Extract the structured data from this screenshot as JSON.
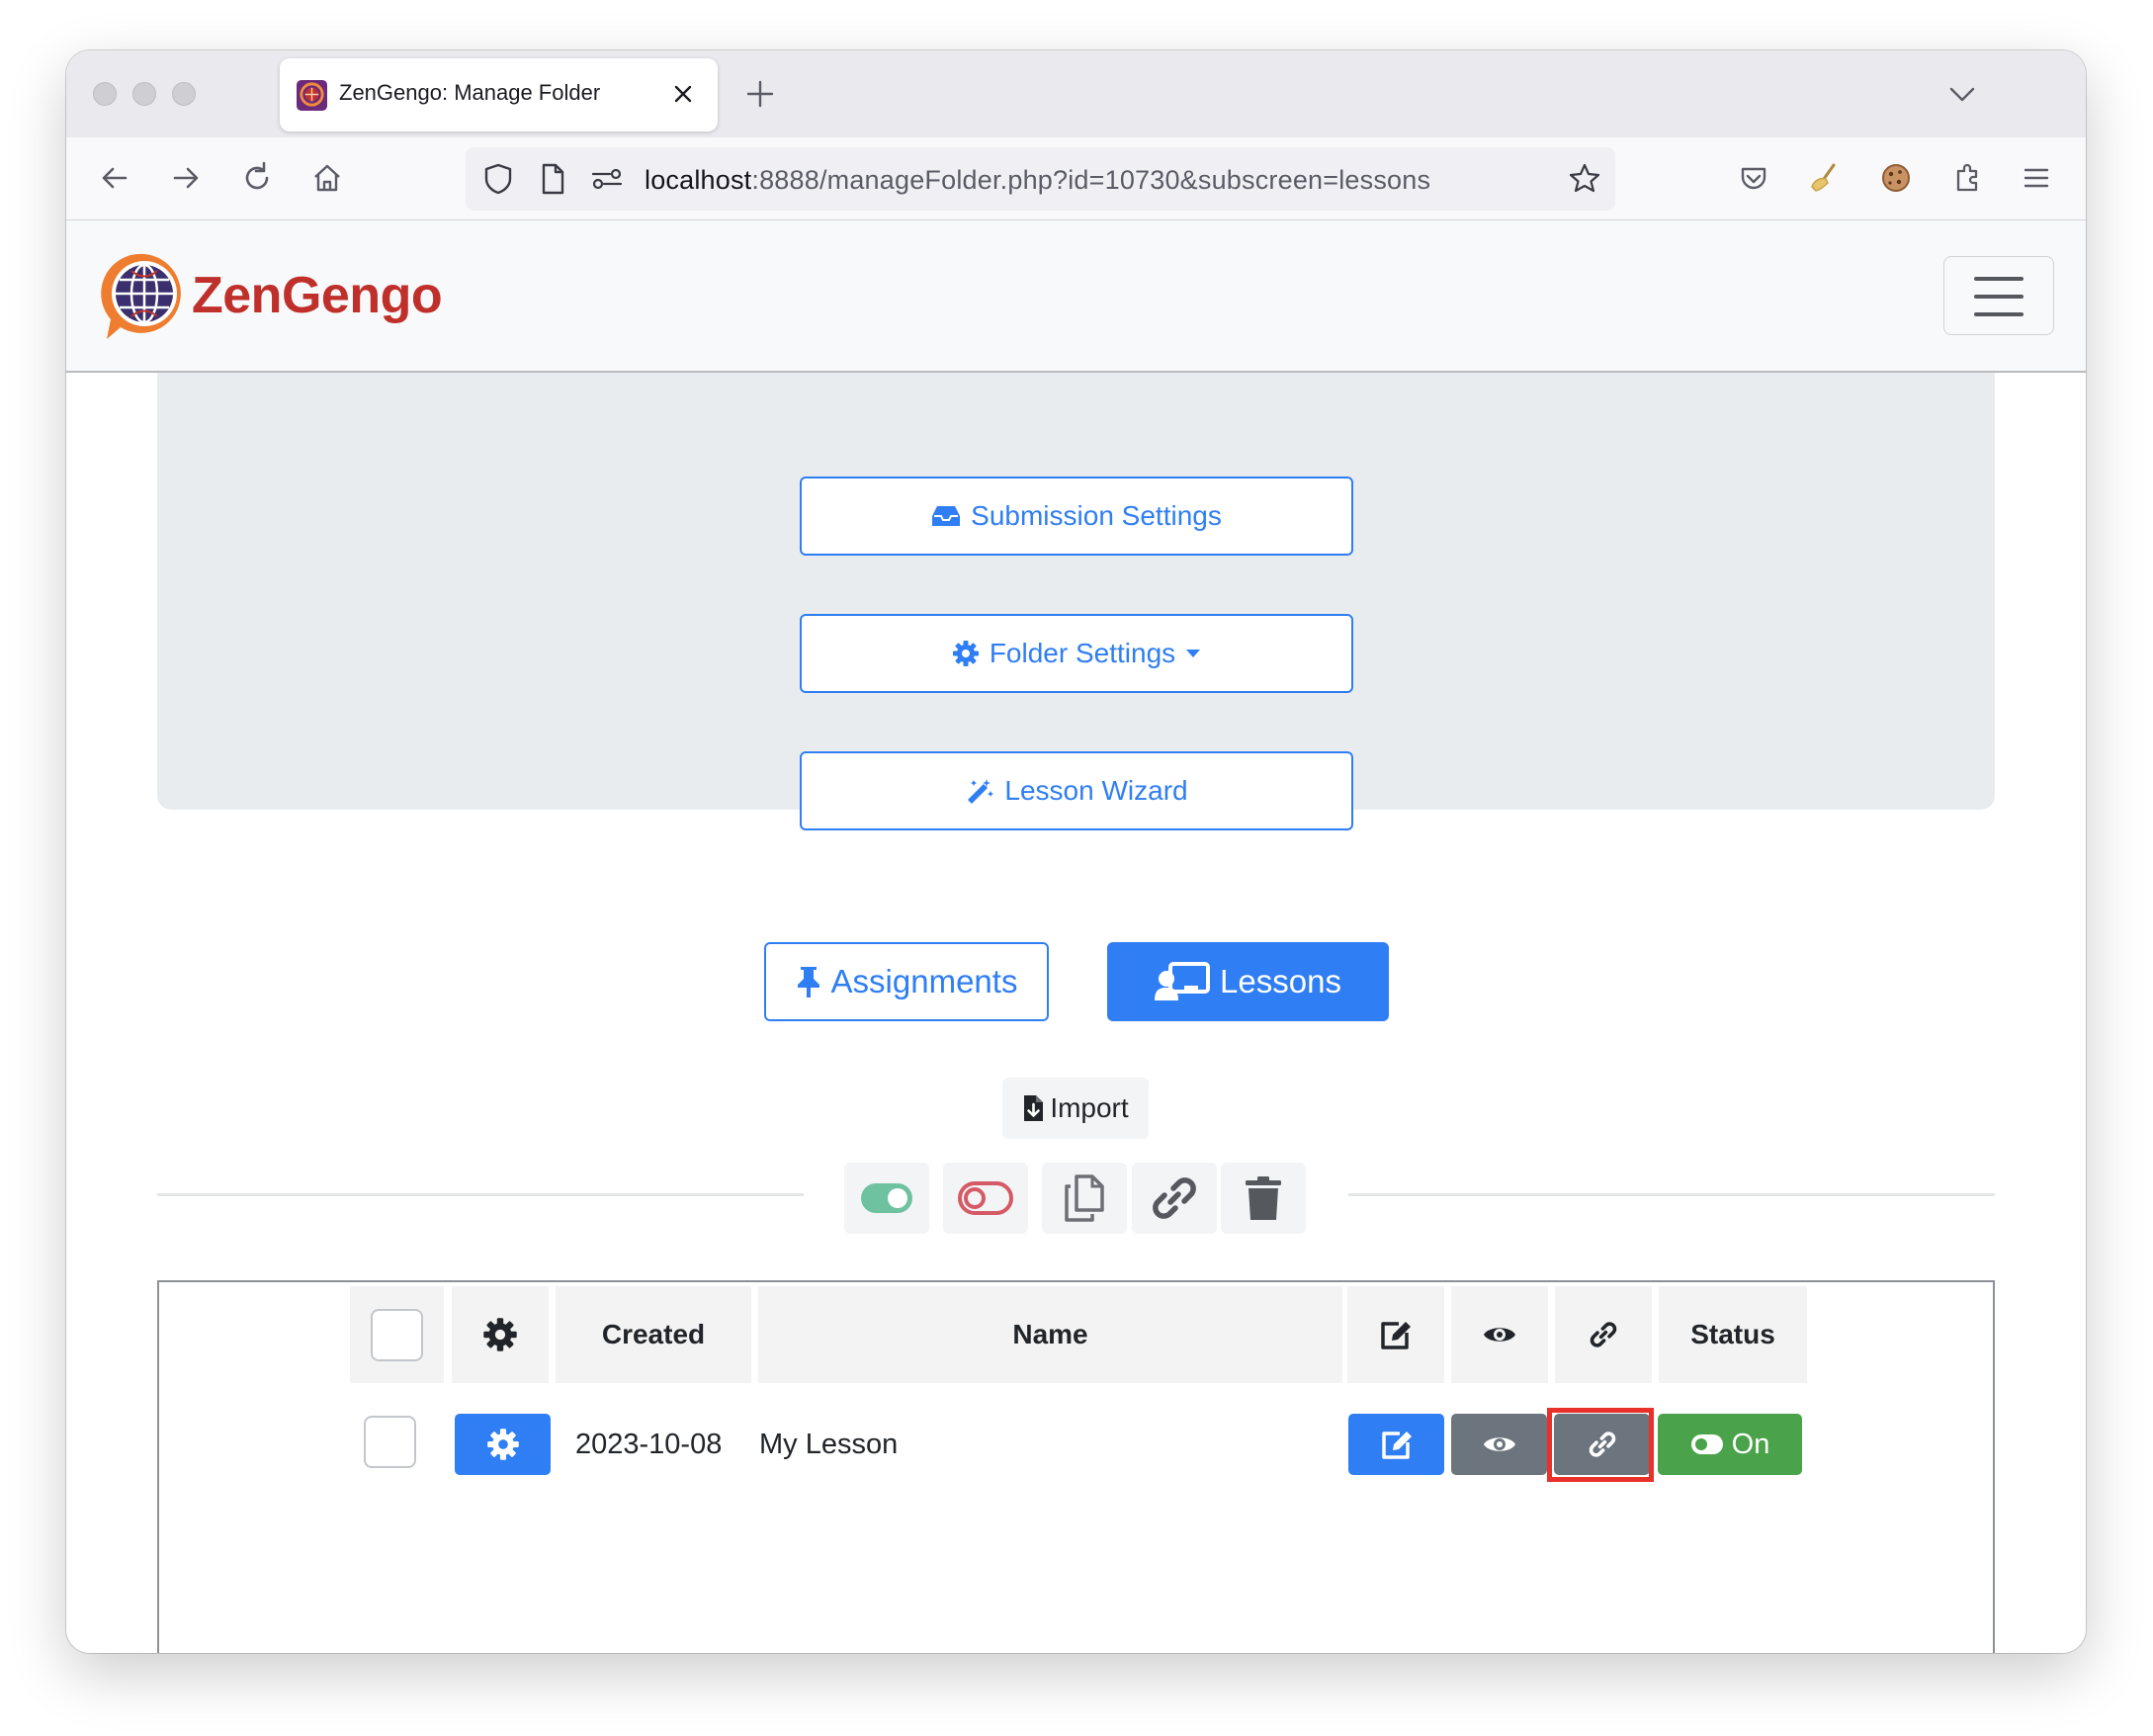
{
  "browser": {
    "tab_title": "ZenGengo: Manage Folder",
    "url_host": "localhost",
    "url_rest": ":8888/manageFolder.php?id=10730&subscreen=lessons"
  },
  "app": {
    "brand": "ZenGengo"
  },
  "settings": {
    "submission_settings_label": "Submission Settings",
    "folder_settings_label": "Folder Settings",
    "lesson_wizard_label": "Lesson Wizard"
  },
  "views": {
    "assignments_label": "Assignments",
    "lessons_label": "Lessons",
    "active": "Lessons"
  },
  "toolbar": {
    "import_label": "Import",
    "bulk_actions": [
      "toggle-on-icon",
      "toggle-off-icon",
      "copy-icon",
      "link-icon",
      "trash-icon"
    ]
  },
  "table": {
    "headers": {
      "created": "Created",
      "name": "Name",
      "status": "Status"
    },
    "rows": [
      {
        "created": "2023-10-08",
        "name": "My Lesson",
        "status": "On"
      }
    ]
  },
  "colors": {
    "primary": "#2f7ef3",
    "secondary": "#6c757d",
    "success": "#4aa24a",
    "brand": "#c0302b",
    "highlight": "#e7312a"
  }
}
